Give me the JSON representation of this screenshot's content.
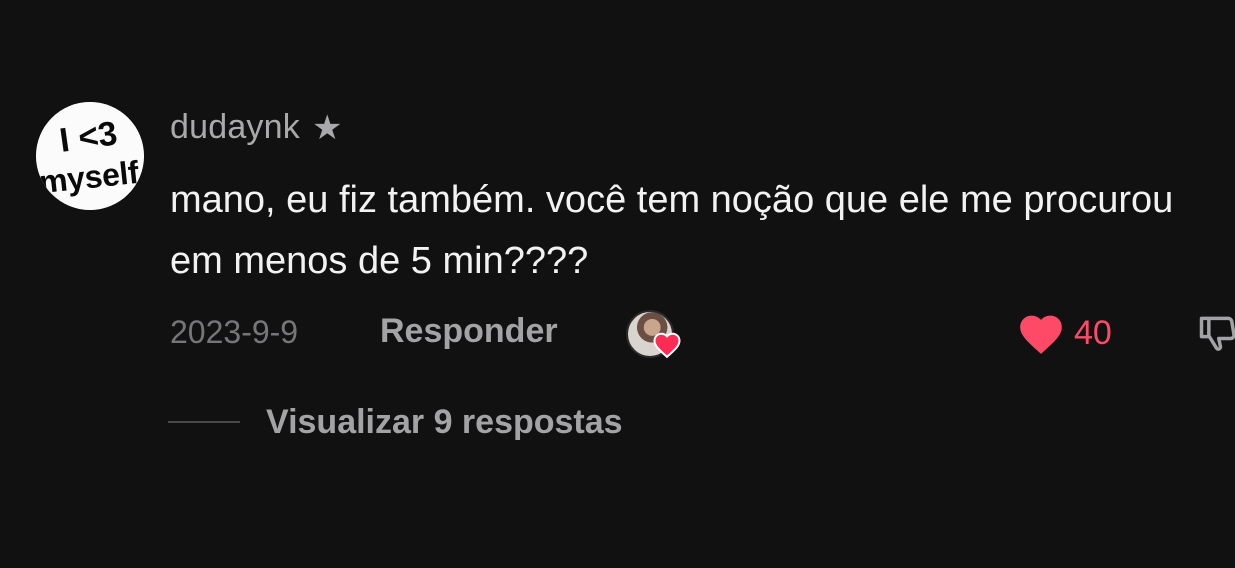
{
  "comment": {
    "avatar_text": [
      "I <3",
      "myself"
    ],
    "username": "dudaynk",
    "badge_icon": "star-icon",
    "text": "mano, eu fiz também. você tem noção que ele me procurou em menos de 5 min????",
    "date": "2023-9-9",
    "reply_label": "Responder",
    "creator_liked_icon": "heart-icon",
    "like_icon": "heart-icon",
    "like_count": "40",
    "dislike_icon": "thumbs-down-icon",
    "view_replies_label": "Visualizar 9 respostas"
  },
  "colors": {
    "background": "#121112",
    "like_accent": "#fe4a67",
    "text_primary": "#f2f2f2",
    "text_secondary": "#a3a3a6"
  }
}
